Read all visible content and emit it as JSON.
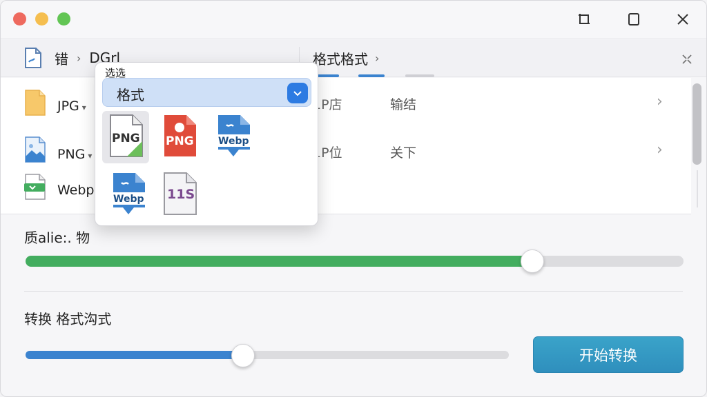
{
  "titlebar": {
    "icons": [
      "close-dot",
      "minimize-dot",
      "zoom-dot",
      "restore-icon",
      "maximize-icon",
      "close-icon"
    ]
  },
  "breadcrumb": {
    "left_folder": "错",
    "left_current": "DGrl",
    "right_title": "格式格式"
  },
  "files": [
    {
      "name": "JPG",
      "col2": "1P店",
      "col3": "输结",
      "icon": "jpg-file-icon"
    },
    {
      "name": "PNG",
      "col2": "1P位",
      "col3": "关下",
      "icon": "png-file-icon"
    },
    {
      "name": "Webp",
      "col2": "",
      "col3": "",
      "icon": "webp-file-icon"
    }
  ],
  "popup": {
    "label": "选选",
    "select_value": "格式",
    "formats": [
      {
        "label": "PNG",
        "selected": true
      },
      {
        "label": "PNG",
        "selected": false
      },
      {
        "label": "Webp",
        "selected": false
      },
      {
        "label": "Webp",
        "selected": false
      },
      {
        "label": "11S",
        "selected": false
      }
    ]
  },
  "quality": {
    "label": "质alie:. 物",
    "value_fraction": 0.77,
    "color": "#43ad5f"
  },
  "convert": {
    "label": "转换 格式沟式",
    "value_fraction": 0.45,
    "color": "#3b83cf",
    "start_button": "开始转换"
  }
}
